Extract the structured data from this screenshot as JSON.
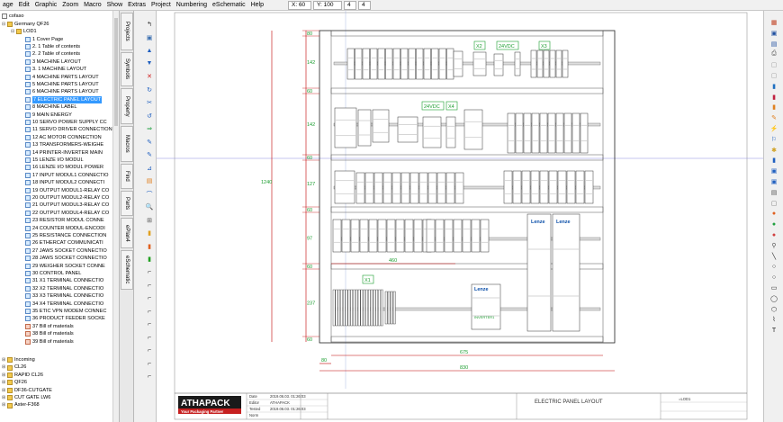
{
  "menu": [
    "age",
    "Edit",
    "Graphic",
    "Zoom",
    "Macro",
    "Show",
    "Extras",
    "Project",
    "Numbering",
    "eSchematic",
    "Help"
  ],
  "coords": {
    "x": "X: 60",
    "y": "Y: 100",
    "f1": "4",
    "f2": "4"
  },
  "tree": {
    "root": "cofaso",
    "project": "Germany QF26",
    "group": "LOD1",
    "pages": [
      "1 Cover Page",
      "2. 1 Table of contents",
      "2. 2 Table of contents",
      "3 MACHINE LAYOUT",
      "3. 1 MACHINE LAYOUT",
      "4 MACHINE PARTS LAYOUT",
      "5 MACHINE PARTS LAYOUT",
      "6 MACHINE PARTS LAYOUT",
      "7 ELECTRIC PANEL LAYOUT",
      "8 MACHINE LABEL",
      "9 MAIN ENERGY",
      "10 SERVO POWER SUPPLY CC",
      "11 SERVO DRIVER CONNECTION",
      "12 AC MOTOR CONNECTION",
      "13 TRANSFORMERS-WEIGHE",
      "14 PRINTER-INVERTER MAIN",
      "15 LENZE I/O MODUL",
      "16 LENZE I/O MODUL POWER",
      "17 INPUT MODUL1 CONNECTIO",
      "18 INPUT MODUL2 CONNECTI",
      "19 OUTPUT MODUL1-RELAY CO",
      "20 OUTPUT MODUL2-RELAY CO",
      "21 OUTPUT MODUL3-RELAY CO",
      "22 OUTPUT MODUL4-RELAY CO",
      "23 RESISTOR MODUL CONNE",
      "24 COUNTER MODUL-ENCODI",
      "25 RESISTANCE CONNECTION",
      "26 ETHERCAT COMMUNICATI",
      "27 JAWS SOCKET CONNECTIO",
      "28 JAWS SOCKET CONNECTIO",
      "29 WEIGHER SOCKET CONNE",
      "30 CONTROL PANEL",
      "31 X1 TERMINAL CONNECTIO",
      "32 X2 TERMINAL CONNECTIO",
      "33 X3 TERMINAL CONNECTIO",
      "34 X4 TERMINAL CONNECTIO",
      "35 ETIC VPN MODEM CONNEC",
      "36 PRODUCT FEEDER SOCKE",
      "37 Bill of materials",
      "38 Bill of materials",
      "39 Bill of materials"
    ],
    "selected_index": 8,
    "other_projects": [
      "Incoming",
      "CL26",
      "RAPID CL26",
      "QF26",
      "DF36-CUTGATE",
      "CUT GATE LW6",
      "Aster-F368"
    ]
  },
  "side_tabs": [
    "Projects",
    "Symbols",
    "Property",
    "Macros",
    "Find",
    "Parts",
    "ePlan4",
    "eSchematic"
  ],
  "drawing": {
    "labels": {
      "x2": "X2",
      "v24a": "24VDC",
      "x3": "X3",
      "v24b": "24VDC",
      "x4": "X4",
      "x1": "X1",
      "lenze1": "Lenze",
      "lenze2": "Lenze",
      "lenze3": "Lenze",
      "inverter": "INVERTER1"
    },
    "dims": {
      "d1": "80",
      "d2": "142",
      "d3": "60",
      "d4": "142",
      "d5": "60",
      "d6": "127",
      "d7": "60",
      "d8": "97",
      "d9": "60",
      "d10": "237",
      "d11": "60",
      "total_h": "1240",
      "w460": "460",
      "w675": "675",
      "w830": "830",
      "w80": "80"
    },
    "title_block": {
      "logo": "ATHAPACK",
      "tagline": "Your Packaging Partner",
      "rows": [
        "Date",
        "Editor",
        "Tested",
        "Norm"
      ],
      "row_values": [
        "2019.06.03. 01:26:03",
        "ATHAPACK",
        "2019.06.03. 01:26:03",
        ""
      ],
      "title": "ELECTRIC PANEL LAYOUT",
      "sheet": "=LOD1"
    }
  },
  "colors": {
    "accent": "#3399ff",
    "dimension": "#1b9d2f",
    "redline": "#c00000"
  }
}
